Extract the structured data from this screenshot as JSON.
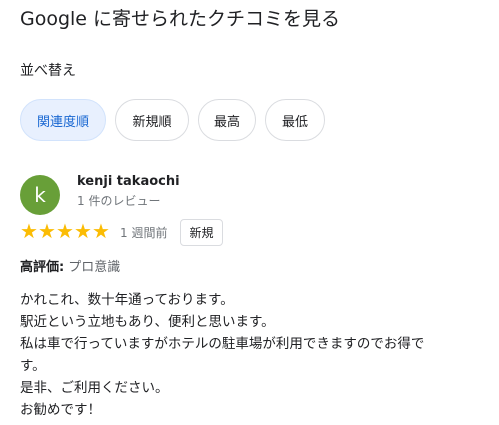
{
  "header": {
    "title": "Google に寄せられたクチコミを見る"
  },
  "sort": {
    "label": "並べ替え",
    "options": [
      "関連度順",
      "新規順",
      "最高",
      "最低"
    ],
    "selected": "関連度順"
  },
  "review": {
    "avatar_letter": "k",
    "reviewer_name": "kenji takaochi",
    "review_count": "1 件のレビュー",
    "stars": 5,
    "star_glyph": "★",
    "time": "1 週間前",
    "badge": "新規",
    "highlight_key": "高評価:",
    "highlight_value": "プロ意識",
    "lines": [
      "かれこれ、数十年通っております。",
      "駅近という立地もあり、便利と思います。",
      "私は車で行っていますがホテルの駐車場が利用できますのでお得で",
      "す。",
      "是非、ご利用ください。",
      "お勧めです！"
    ]
  },
  "colors": {
    "accent": "#1967d2",
    "chip_selected_bg": "#e8f0fe",
    "star": "#fbbc04",
    "avatar": "#689f38"
  }
}
